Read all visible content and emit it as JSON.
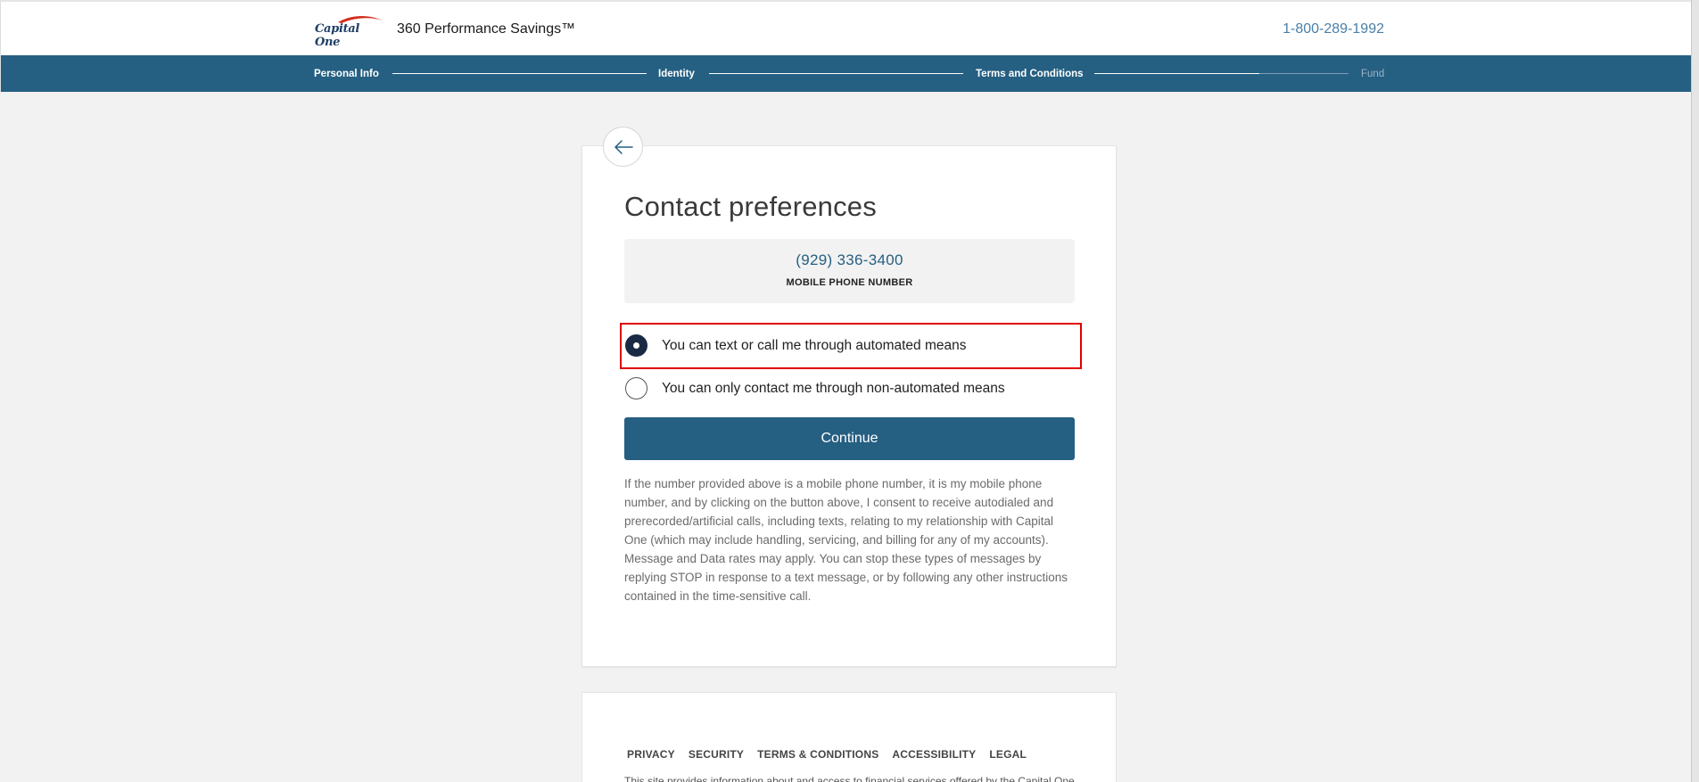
{
  "header": {
    "logo_text": "Capital One",
    "product_title": "360 Performance Savings™",
    "phone": "1-800-289-1992"
  },
  "progress": {
    "steps": [
      {
        "label": "Personal Info",
        "state": "complete"
      },
      {
        "label": "Identity",
        "state": "complete"
      },
      {
        "label": "Terms and Conditions",
        "state": "current"
      },
      {
        "label": "Fund",
        "state": "upcoming"
      }
    ],
    "last_segment_fill": 0.65
  },
  "card": {
    "back_icon": "arrow-left-icon",
    "title": "Contact preferences",
    "phone_number": "(929) 336-3400",
    "phone_label": "MOBILE PHONE NUMBER",
    "options": [
      {
        "label": "You can text or call me through automated means",
        "selected": true
      },
      {
        "label": "You can only contact me through non-automated means",
        "selected": false
      }
    ],
    "continue_label": "Continue",
    "disclosure": "If the number provided above is a mobile phone number, it is my mobile phone number, and by clicking on the button above, I consent to receive autodialed and prerecorded/artificial calls, including texts, relating to my relationship with Capital One (which may include handling, servicing, and billing for any of my accounts). Message and Data rates may apply. You can stop these types of messages by replying STOP in response to a text message, or by following any other instructions contained in the time-sensitive call."
  },
  "footer": {
    "links": [
      "PRIVACY",
      "SECURITY",
      "TERMS & CONDITIONS",
      "ACCESSIBILITY",
      "LEGAL"
    ],
    "text": "This site provides information about and access to financial services offered by the Capital One"
  },
  "colors": {
    "brand_blue": "#255f82",
    "highlight_red": "#e00000",
    "radio_selected": "#1b2a44"
  }
}
